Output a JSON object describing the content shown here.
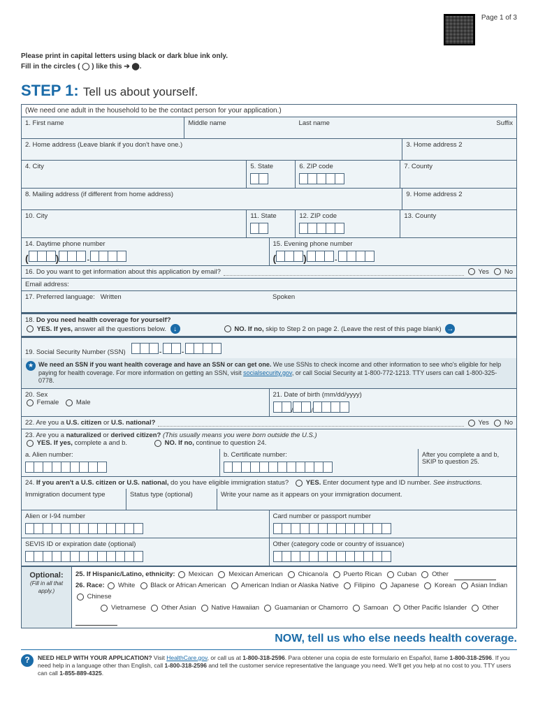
{
  "page_num": "Page 1 of 3",
  "instruct1": "Please print in capital letters using black or dark blue ink only.",
  "instruct2": "Fill in the circles ( ◯ ) like this ➔ ⬤.",
  "step_h": "STEP 1:",
  "step_sub": "Tell us about yourself.",
  "subtitle": "(We need one adult in the household to be the contact person for your application.)",
  "f": {
    "l1": "1. First name",
    "l1b": "Middle name",
    "l1c": "Last name",
    "l1d": "Suffix",
    "l2": "2. Home address (Leave blank if you don't have one.)",
    "l3": "3. Home address 2",
    "l4": "4. City",
    "l5": "5. State",
    "l6": "6. ZIP code",
    "l7": "7. County",
    "l8": "8. Mailing address (if different from home address)",
    "l9": "9. Home address 2",
    "l10": "10. City",
    "l11": "11. State",
    "l12": "12. ZIP code",
    "l13": "13. County",
    "l14": "14. Daytime phone number",
    "l15": "15. Evening phone number",
    "l16": "16. Do you want to get information about this application by email?",
    "l16e": "Email address:",
    "l17": "17. Preferred language:",
    "l17a": "Written",
    "l17b": "Spoken",
    "l18": "18.",
    "l18b": "Do you need health coverage for yourself?",
    "l18yes": "YES. If yes,",
    "l18yes2": " answer all the questions below.",
    "l18no": "NO. If no,",
    "l18no2": " skip to Step 2 on page 2. (Leave the rest of this page blank)",
    "l19": "19. Social Security Number (SSN)",
    "ssn_info_b": "We need an SSN if you want health coverage and have an SSN or can get one.",
    "ssn_info": " We use SSNs to check income and other information to see who's eligible for help paying for health coverage. For more information on getting an SSN, visit ",
    "ssn_link": "socialsecurity.gov",
    "ssn_info2": ", or call Social Security at 1-800-772-1213. TTY users can call 1-800-325-0778.",
    "l20": "20. Sex",
    "l20f": "Female",
    "l20m": "Male",
    "l21": "21. Date of birth (mm/dd/yyyy)",
    "l22a": "22. Are you a ",
    "l22b": "U.S. citizen",
    "l22c": " or ",
    "l22d": "U.S. national?",
    "l23": "23. Are you a ",
    "l23b": "naturalized",
    "l23c": " or ",
    "l23d": "derived citizen?",
    "l23e": " (This usually means you were born outside the U.S.)",
    "l23yes": "YES. If yes,",
    "l23yes2": " complete a and b.",
    "l23no": "NO. If no,",
    "l23no2": " continue to question 24.",
    "l23a": "a. Alien number:",
    "l23bb": "b. Certificate number:",
    "l23skip": "After you complete a and b, SKIP to question 25.",
    "l24": "24.",
    "l24b": " If you aren't a U.S. citizen or U.S. national,",
    "l24c": " do you have eligible immigration status?",
    "l24yes": "YES.",
    "l24yes2": " Enter document type and ID number. ",
    "l24i": "See instructions.",
    "l24d": "Immigration document type",
    "l24e": "Status type (optional)",
    "l24f": "Write your name as it appears on your immigration document.",
    "l24g": "Alien or I-94 number",
    "l24h": "Card number or passport number",
    "l24j": "SEVIS ID or expiration date (optional)",
    "l24k": "Other (category code or country of issuance)",
    "opt": "Optional:",
    "opt2": "(Fill in all that apply.)",
    "l25": "25. If Hispanic/Latino, ethnicity:",
    "eth": [
      "Mexican",
      "Mexican American",
      "Chicano/a",
      "Puerto Rican",
      "Cuban",
      "Other"
    ],
    "l26": "26. Race:",
    "race1": [
      "White",
      "Black or African American",
      "American Indian or Alaska Native",
      "Filipino",
      "Japanese",
      "Korean",
      "Asian Indian",
      "Chinese"
    ],
    "race2": [
      "Vietnamese",
      "Other Asian",
      "Native Hawaiian",
      "Guamanian or Chamorro",
      "Samoan",
      "Other Pacific Islander",
      "Other"
    ]
  },
  "yes": "Yes",
  "no": "No",
  "cta": "NOW, tell us who else needs health coverage.",
  "help_b": "NEED HELP WITH YOUR APPLICATION?",
  "help1": " Visit ",
  "help_link": "HealthCare.gov",
  "help2": ", or call us at ",
  "help_ph": "1-800-318-2596",
  "help3": ". Para obtener una copia de este formulario en Español, llame ",
  "help4": ". If you need help in a language other than English, call ",
  "help5": " and tell the customer service representative the language you need. We'll get you help at no cost to you. TTY users can call ",
  "help_tty": "1-855-889-4325",
  "help6": "."
}
